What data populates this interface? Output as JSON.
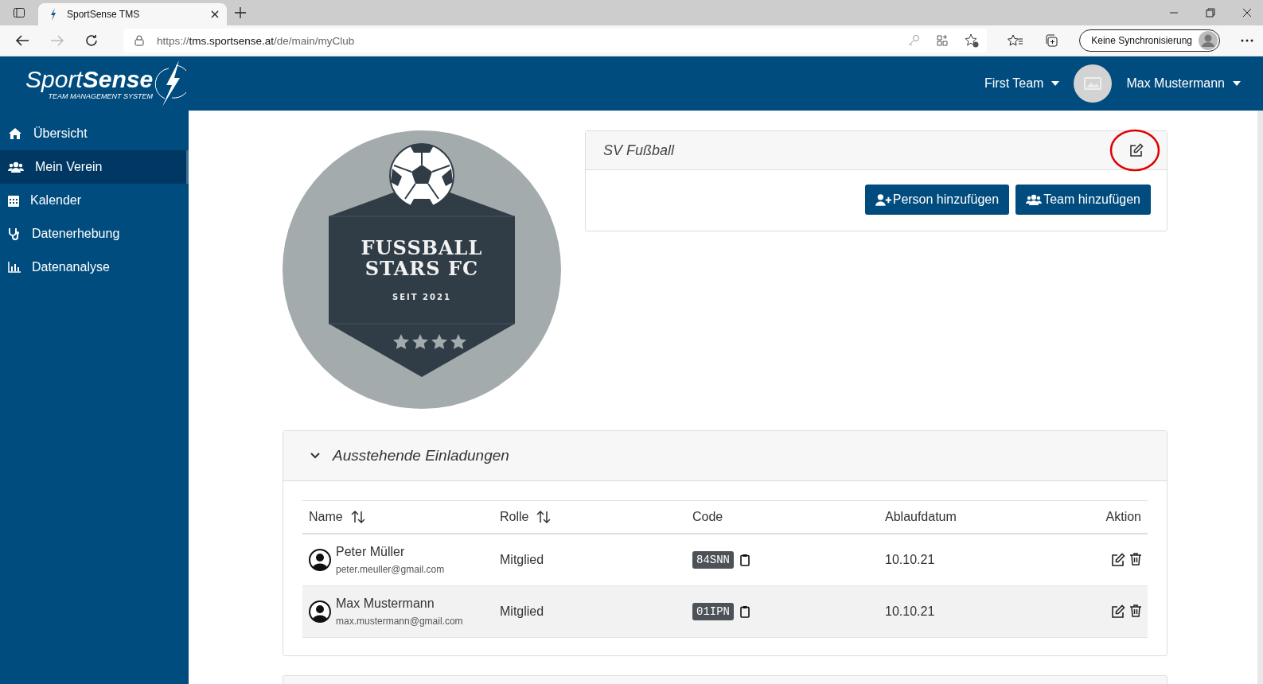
{
  "browser": {
    "tab_title": "SportSense TMS",
    "address": {
      "scheme": "https://",
      "host": "tms.sportsense.at",
      "path": "/de/main/myClub"
    },
    "sync_button": "Keine Synchronisierung"
  },
  "header": {
    "logo": {
      "brand_light": "Sport",
      "brand_bold": "Sense",
      "tagline": "TEAM MANAGEMENT SYSTEM"
    },
    "team_menu": "First Team",
    "user_menu": "Max Mustermann"
  },
  "sidebar": {
    "items": [
      {
        "label": "Übersicht",
        "kind": "home",
        "selected": false
      },
      {
        "label": "Mein Verein",
        "kind": "users",
        "selected": true
      },
      {
        "label": "Kalender",
        "kind": "calendar",
        "selected": false
      },
      {
        "label": "Datenerhebung",
        "kind": "stethoscope",
        "selected": false
      },
      {
        "label": "Datenanalyse",
        "kind": "chart",
        "selected": false
      }
    ]
  },
  "club_logo": {
    "line_1": "FUSSBALL",
    "line_2": "STARS FC",
    "since": "SEIT 2021"
  },
  "club_card": {
    "title": "SV Fußball",
    "buttons": [
      {
        "label": "Person hinzufügen",
        "kind": "person"
      },
      {
        "label": "Team hinzufügen",
        "kind": "team"
      }
    ]
  },
  "invitations": {
    "title": "Ausstehende Einladungen",
    "expanded": true,
    "columns": [
      {
        "label": "Name",
        "sortable": true
      },
      {
        "label": "Rolle",
        "sortable": true
      },
      {
        "label": "Code",
        "sortable": false
      },
      {
        "label": "Ablaufdatum",
        "sortable": false
      },
      {
        "label": "Aktion",
        "sortable": false
      }
    ],
    "rows": [
      {
        "name": "Peter Müller",
        "email": "peter.meuller@gmail.com",
        "role": "Mitglied",
        "code": "84SNN",
        "expires": "10.10.21",
        "selected": false
      },
      {
        "name": "Max Mustermann",
        "email": "max.mustermann@gmail.com",
        "role": "Mitglied",
        "code": "01IPN",
        "expires": "10.10.21",
        "selected": true
      }
    ]
  }
}
